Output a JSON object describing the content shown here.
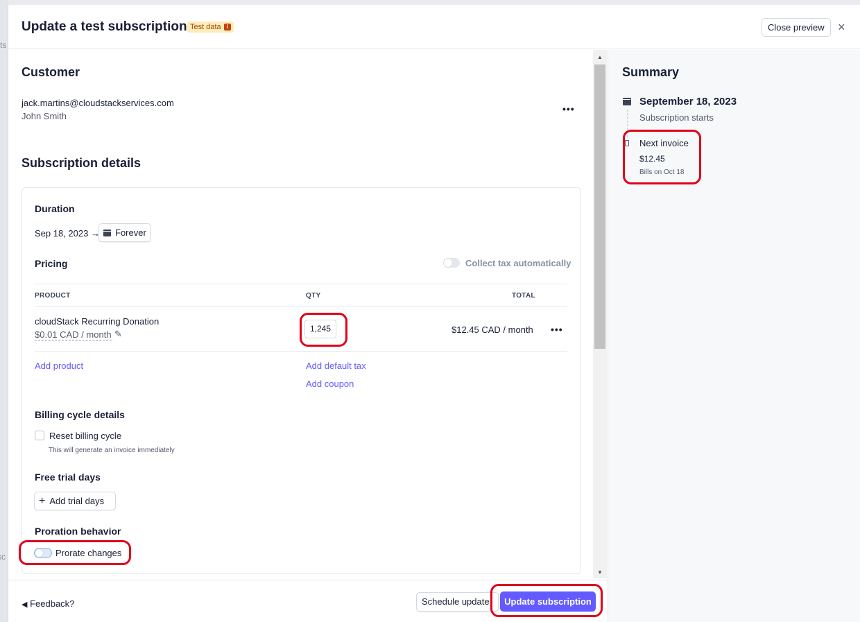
{
  "header": {
    "title": "Update a test subscription",
    "badge": "Test data",
    "close_preview": "Close preview",
    "close_icon": "×"
  },
  "customer": {
    "heading": "Customer",
    "email": "jack.martins@cloudstackservices.com",
    "name": "John Smith",
    "more": "•••"
  },
  "subscription": {
    "heading": "Subscription details",
    "duration": {
      "heading": "Duration",
      "start": "Sep 18, 2023 →",
      "end_label": "Forever"
    },
    "pricing": {
      "heading": "Pricing",
      "collect_tax": "Collect tax automatically",
      "columns": {
        "product": "PRODUCT",
        "qty": "QTY",
        "total": "TOTAL"
      },
      "item": {
        "name": "cloudStack Recurring Donation",
        "price": "$0.01 CAD / month",
        "qty": "1,245",
        "total": "$12.45 CAD / month",
        "more": "•••"
      },
      "add_product": "Add product",
      "add_default_tax": "Add default tax",
      "add_coupon": "Add coupon"
    },
    "billing_cycle": {
      "heading": "Billing cycle details",
      "reset_label": "Reset billing cycle",
      "reset_hint": "This will generate an invoice immediately"
    },
    "trial": {
      "heading": "Free trial days",
      "add_trial": "Add trial days"
    },
    "proration": {
      "heading": "Proration behavior",
      "prorate_label": "Prorate changes"
    }
  },
  "footer": {
    "feedback": "Feedback?",
    "schedule_update": "Schedule update",
    "update_subscription": "Update subscription"
  },
  "summary": {
    "heading": "Summary",
    "start_date": "September 18, 2023",
    "start_label": "Subscription starts",
    "next_invoice_label": "Next invoice",
    "next_invoice_amount": "$12.45",
    "bills_on": "Bills on Oct 18"
  },
  "colors": {
    "accent": "#635bff",
    "badge_bg": "#fcedb9",
    "highlight": "#e0001a"
  }
}
